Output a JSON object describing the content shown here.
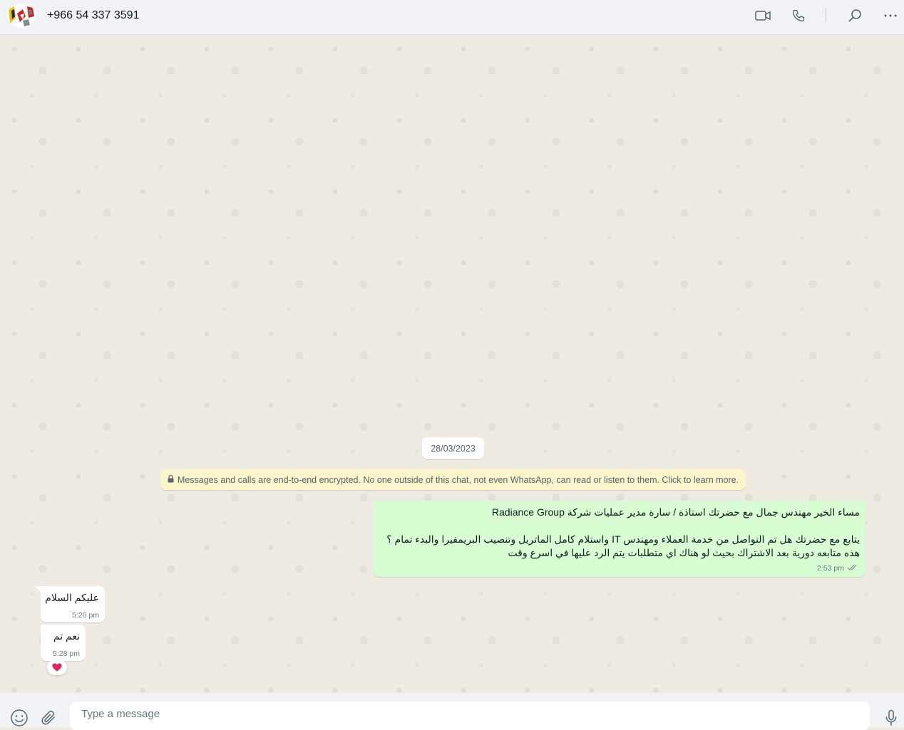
{
  "header": {
    "contact_name": "+966 54 337 3591",
    "icons": [
      "video-call-icon",
      "voice-call-icon",
      "search-icon",
      "more-options-icon"
    ]
  },
  "chat": {
    "date_chip": "28/03/2023",
    "encryption_notice": "Messages and calls are end-to-end encrypted. No one outside of this chat, not even WhatsApp, can read or listen to them. Click to learn more.",
    "outgoing_message": {
      "text": "مساء الخير مهندس جمال مع حضرتك استاذة / سارة مدير عمليات شركة Radiance Group\n\nيتابع مع حضرتك هل تم التواصل من خدمة العملاء ومهندس IT واستلام كامل الماتريل وتنصيب البريمفيرا والبدء تمام ؟\nهذه متابعه دورية بعد الاشتراك بحيث لو هناك اي متطلبات يتم الرد عليها في اسرع وقت",
      "time": "2:53 pm",
      "status": "read"
    },
    "incoming_messages": [
      {
        "text": "عليكم السلام",
        "time": "5:20 pm"
      },
      {
        "text": "نعم تم",
        "time": "5:28 pm",
        "reaction": "❤️"
      }
    ]
  },
  "footer": {
    "placeholder": "Type a message",
    "value": "",
    "icons": [
      "emoji-icon",
      "attach-icon",
      "microphone-icon"
    ]
  },
  "colors": {
    "outgoing_bubble": "#d9fdd3",
    "incoming_bubble": "#ffffff",
    "chat_background": "#efeae2",
    "encryption_notice": "#fcf4cb",
    "read_ticks": "#8696a0"
  }
}
